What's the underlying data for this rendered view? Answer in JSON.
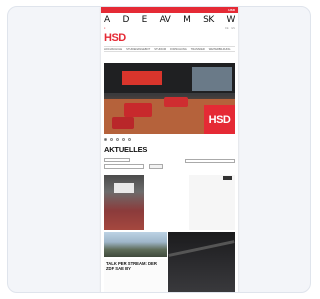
{
  "topbar": {
    "text": "HSD"
  },
  "header": {
    "font_letters": [
      "A",
      "D",
      "E",
      "AV",
      "M",
      "SK",
      "W"
    ],
    "logo": "HSD",
    "subbar_items": [
      "≡",
      "DE",
      "EN"
    ],
    "nav_items": [
      "Hochschule",
      "Studienangebot",
      "Studium",
      "Forschung",
      "Transfer",
      "Weiterbildung"
    ]
  },
  "hero": {
    "badge": "HSD"
  },
  "slider": {
    "dot_count": 5,
    "active_index": 0
  },
  "news": {
    "title": "AKTUELLES",
    "filter_select": "",
    "filter_select2": "",
    "filter_button": "",
    "filter_right": ""
  },
  "cards": [
    {
      "text": ""
    },
    {
      "meta": "",
      "headline": "TALK PER STREAM: DER ZDF SAE BY"
    },
    {
      "text": "",
      "subtext": ""
    }
  ],
  "colors": {
    "brand": "#e52a35",
    "dark": "#111111"
  }
}
